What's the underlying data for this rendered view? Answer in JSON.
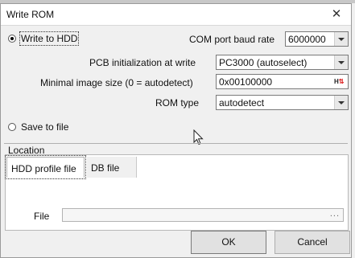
{
  "window": {
    "title": "Write ROM",
    "close_glyph": "✕"
  },
  "mode": {
    "write_to_hdd_label": "Write to HDD",
    "save_to_file_label": "Save to file",
    "selected": "write_to_hdd"
  },
  "baud": {
    "label": "COM port baud rate",
    "value": "6000000"
  },
  "pcb": {
    "label": "PCB initialization at write",
    "value": "PC3000 (autoselect)"
  },
  "min_size": {
    "label": "Minimal image size (0 = autodetect)",
    "value": "0x00100000",
    "hex_icon_text": "H",
    "hex_icon_arrow": "⇅"
  },
  "rom_type": {
    "label": "ROM type",
    "value": "autodetect"
  },
  "location": {
    "label": "Location",
    "tabs": [
      "HDD profile file",
      "DB file"
    ],
    "active_tab": 0,
    "file_label": "File",
    "file_value": "",
    "browse_glyph": "..."
  },
  "buttons": {
    "ok": "OK",
    "cancel": "Cancel"
  },
  "colors": {
    "dialog_bg": "#f0f0f0",
    "field_border": "#7a7a7a",
    "hex_arrow": "#dd2222"
  }
}
